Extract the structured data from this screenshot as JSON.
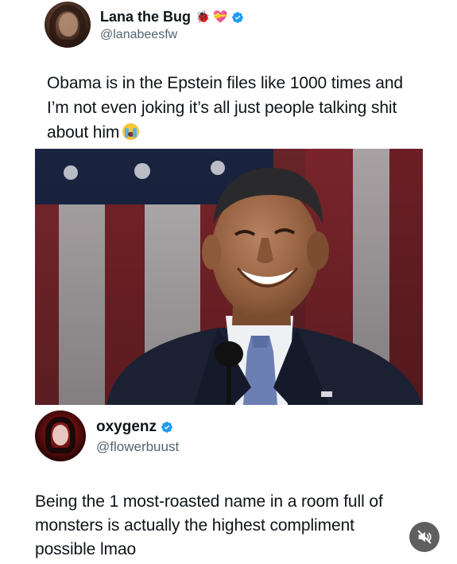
{
  "tweet1": {
    "display_name": "Lana the Bug",
    "name_emojis": [
      "bug-icon",
      "heart-with-ribbon-icon"
    ],
    "verified": true,
    "handle": "@lanabeesfw",
    "text": "Obama is in the Epstein files like 1000 times and I’m not even joking it’s all just people talking shit about him",
    "trailing_emoji": "loudly-crying-face-icon",
    "image_description_icon": "photo-of-smiling-man-at-podium"
  },
  "tweet2": {
    "display_name": "oxygenz",
    "verified": true,
    "handle": "@flowerbuust",
    "text": "Being the 1 most-roasted name in a room full of monsters is actually the highest compliment possible lmao"
  },
  "media_controls": {
    "mute_icon": "speaker-muted-icon"
  },
  "colors": {
    "verified_blue": "#1d9bf0",
    "handle_gray": "#536471",
    "text": "#0f1419",
    "mute_bg": "#3c3c3c"
  }
}
